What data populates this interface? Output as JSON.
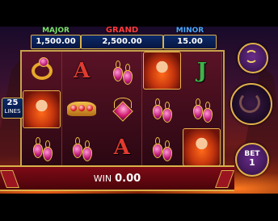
{
  "jackpots": {
    "major": {
      "title": "MAJOR",
      "value": "1,500.00"
    },
    "grand": {
      "title": "GRAND",
      "value": "2,500.00"
    },
    "minor": {
      "title": "MINOR",
      "value": "15.00"
    }
  },
  "lines": {
    "count": "25",
    "label": "LINES"
  },
  "reels": [
    [
      "ring",
      "lady",
      "earrings"
    ],
    [
      "letter-A",
      "crown",
      "earrings"
    ],
    [
      "earrings",
      "heart-pendant",
      "letter-A"
    ],
    [
      "lady",
      "earrings",
      "earrings"
    ],
    [
      "letter-J",
      "earrings",
      "lady"
    ]
  ],
  "symbol_letters": {
    "A": "A",
    "J": "J"
  },
  "bet": {
    "label": "BET",
    "value": "1"
  },
  "win": {
    "label": "WIN",
    "value": "0.00"
  },
  "icons": {
    "autospin": "autospin-icon",
    "spin": "spin-icon"
  }
}
